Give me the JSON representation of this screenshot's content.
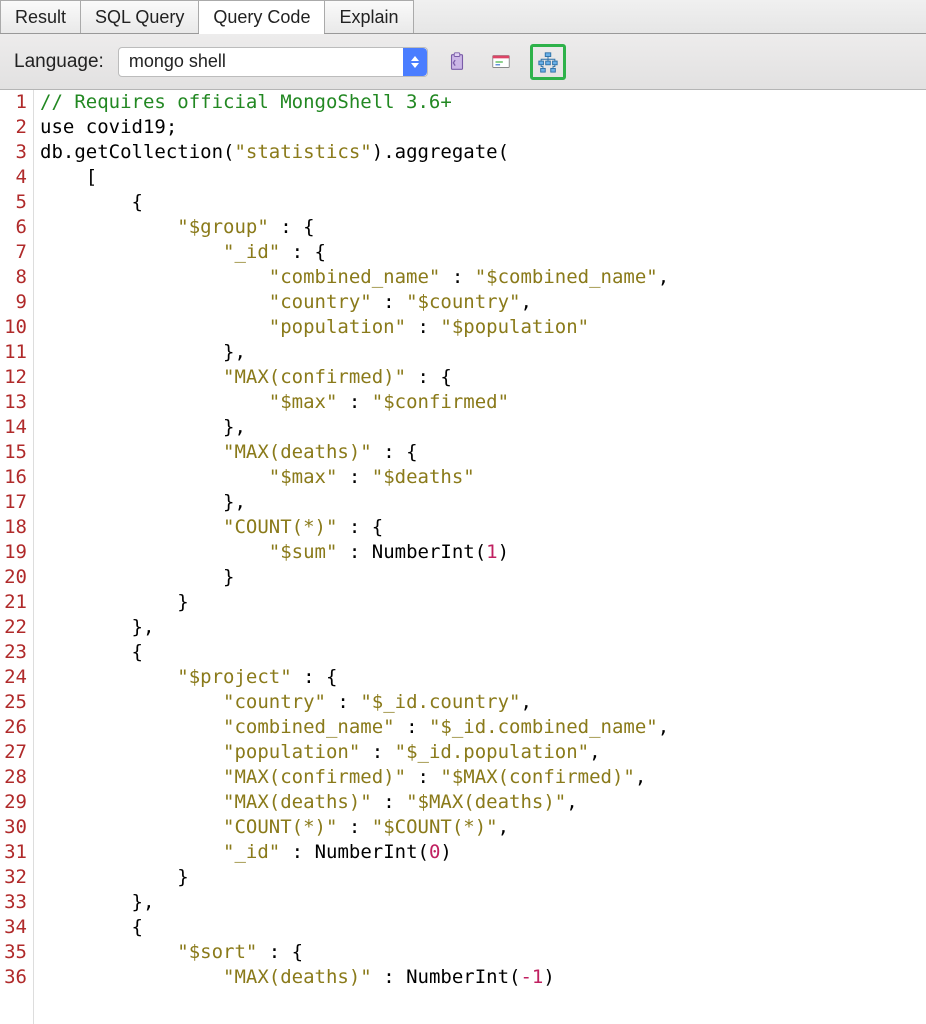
{
  "tabs": {
    "result": "Result",
    "sql": "SQL Query",
    "code": "Query Code",
    "explain": "Explain",
    "active": "code"
  },
  "toolbar": {
    "language_label": "Language:",
    "language_value": "mongo shell"
  },
  "code_lines": [
    {
      "n": 1,
      "segs": [
        {
          "t": "// Requires official MongoShell 3.6+",
          "c": "c-comment"
        }
      ]
    },
    {
      "n": 2,
      "segs": [
        {
          "t": "use covid19;",
          "c": "c-ident"
        }
      ]
    },
    {
      "n": 3,
      "segs": [
        {
          "t": "db.getCollection(",
          "c": "c-ident"
        },
        {
          "t": "\"statistics\"",
          "c": "c-str"
        },
        {
          "t": ").aggregate(",
          "c": "c-ident"
        }
      ]
    },
    {
      "n": 4,
      "segs": [
        {
          "t": "    [",
          "c": "c-punct"
        }
      ]
    },
    {
      "n": 5,
      "segs": [
        {
          "t": "        {",
          "c": "c-punct"
        }
      ]
    },
    {
      "n": 6,
      "segs": [
        {
          "t": "            ",
          "c": ""
        },
        {
          "t": "\"$group\"",
          "c": "c-key"
        },
        {
          "t": " : {",
          "c": "c-punct"
        }
      ]
    },
    {
      "n": 7,
      "segs": [
        {
          "t": "                ",
          "c": ""
        },
        {
          "t": "\"_id\"",
          "c": "c-key"
        },
        {
          "t": " : {",
          "c": "c-punct"
        }
      ]
    },
    {
      "n": 8,
      "segs": [
        {
          "t": "                    ",
          "c": ""
        },
        {
          "t": "\"combined_name\"",
          "c": "c-key"
        },
        {
          "t": " : ",
          "c": "c-punct"
        },
        {
          "t": "\"$combined_name\"",
          "c": "c-str"
        },
        {
          "t": ",",
          "c": "c-punct"
        }
      ]
    },
    {
      "n": 9,
      "segs": [
        {
          "t": "                    ",
          "c": ""
        },
        {
          "t": "\"country\"",
          "c": "c-key"
        },
        {
          "t": " : ",
          "c": "c-punct"
        },
        {
          "t": "\"$country\"",
          "c": "c-str"
        },
        {
          "t": ",",
          "c": "c-punct"
        }
      ]
    },
    {
      "n": 10,
      "segs": [
        {
          "t": "                    ",
          "c": ""
        },
        {
          "t": "\"population\"",
          "c": "c-key"
        },
        {
          "t": " : ",
          "c": "c-punct"
        },
        {
          "t": "\"$population\"",
          "c": "c-str"
        }
      ]
    },
    {
      "n": 11,
      "segs": [
        {
          "t": "                },",
          "c": "c-punct"
        }
      ]
    },
    {
      "n": 12,
      "segs": [
        {
          "t": "                ",
          "c": ""
        },
        {
          "t": "\"MAX(confirmed)\"",
          "c": "c-key"
        },
        {
          "t": " : {",
          "c": "c-punct"
        }
      ]
    },
    {
      "n": 13,
      "segs": [
        {
          "t": "                    ",
          "c": ""
        },
        {
          "t": "\"$max\"",
          "c": "c-key"
        },
        {
          "t": " : ",
          "c": "c-punct"
        },
        {
          "t": "\"$confirmed\"",
          "c": "c-str"
        }
      ]
    },
    {
      "n": 14,
      "segs": [
        {
          "t": "                },",
          "c": "c-punct"
        }
      ]
    },
    {
      "n": 15,
      "segs": [
        {
          "t": "                ",
          "c": ""
        },
        {
          "t": "\"MAX(deaths)\"",
          "c": "c-key"
        },
        {
          "t": " : {",
          "c": "c-punct"
        }
      ]
    },
    {
      "n": 16,
      "segs": [
        {
          "t": "                    ",
          "c": ""
        },
        {
          "t": "\"$max\"",
          "c": "c-key"
        },
        {
          "t": " : ",
          "c": "c-punct"
        },
        {
          "t": "\"$deaths\"",
          "c": "c-str"
        }
      ]
    },
    {
      "n": 17,
      "segs": [
        {
          "t": "                },",
          "c": "c-punct"
        }
      ]
    },
    {
      "n": 18,
      "segs": [
        {
          "t": "                ",
          "c": ""
        },
        {
          "t": "\"COUNT(*)\"",
          "c": "c-key"
        },
        {
          "t": " : {",
          "c": "c-punct"
        }
      ]
    },
    {
      "n": 19,
      "segs": [
        {
          "t": "                    ",
          "c": ""
        },
        {
          "t": "\"$sum\"",
          "c": "c-key"
        },
        {
          "t": " : ",
          "c": "c-punct"
        },
        {
          "t": "NumberInt(",
          "c": "c-fn"
        },
        {
          "t": "1",
          "c": "c-num"
        },
        {
          "t": ")",
          "c": "c-fn"
        }
      ]
    },
    {
      "n": 20,
      "segs": [
        {
          "t": "                }",
          "c": "c-punct"
        }
      ]
    },
    {
      "n": 21,
      "segs": [
        {
          "t": "            }",
          "c": "c-punct"
        }
      ]
    },
    {
      "n": 22,
      "segs": [
        {
          "t": "        },",
          "c": "c-punct"
        }
      ]
    },
    {
      "n": 23,
      "segs": [
        {
          "t": "        {",
          "c": "c-punct"
        }
      ]
    },
    {
      "n": 24,
      "segs": [
        {
          "t": "            ",
          "c": ""
        },
        {
          "t": "\"$project\"",
          "c": "c-key"
        },
        {
          "t": " : {",
          "c": "c-punct"
        }
      ]
    },
    {
      "n": 25,
      "segs": [
        {
          "t": "                ",
          "c": ""
        },
        {
          "t": "\"country\"",
          "c": "c-key"
        },
        {
          "t": " : ",
          "c": "c-punct"
        },
        {
          "t": "\"$_id.country\"",
          "c": "c-str"
        },
        {
          "t": ",",
          "c": "c-punct"
        }
      ]
    },
    {
      "n": 26,
      "segs": [
        {
          "t": "                ",
          "c": ""
        },
        {
          "t": "\"combined_name\"",
          "c": "c-key"
        },
        {
          "t": " : ",
          "c": "c-punct"
        },
        {
          "t": "\"$_id.combined_name\"",
          "c": "c-str"
        },
        {
          "t": ",",
          "c": "c-punct"
        }
      ]
    },
    {
      "n": 27,
      "segs": [
        {
          "t": "                ",
          "c": ""
        },
        {
          "t": "\"population\"",
          "c": "c-key"
        },
        {
          "t": " : ",
          "c": "c-punct"
        },
        {
          "t": "\"$_id.population\"",
          "c": "c-str"
        },
        {
          "t": ",",
          "c": "c-punct"
        }
      ]
    },
    {
      "n": 28,
      "segs": [
        {
          "t": "                ",
          "c": ""
        },
        {
          "t": "\"MAX(confirmed)\"",
          "c": "c-key"
        },
        {
          "t": " : ",
          "c": "c-punct"
        },
        {
          "t": "\"$MAX(confirmed)\"",
          "c": "c-str"
        },
        {
          "t": ",",
          "c": "c-punct"
        }
      ]
    },
    {
      "n": 29,
      "segs": [
        {
          "t": "                ",
          "c": ""
        },
        {
          "t": "\"MAX(deaths)\"",
          "c": "c-key"
        },
        {
          "t": " : ",
          "c": "c-punct"
        },
        {
          "t": "\"$MAX(deaths)\"",
          "c": "c-str"
        },
        {
          "t": ",",
          "c": "c-punct"
        }
      ]
    },
    {
      "n": 30,
      "segs": [
        {
          "t": "                ",
          "c": ""
        },
        {
          "t": "\"COUNT(*)\"",
          "c": "c-key"
        },
        {
          "t": " : ",
          "c": "c-punct"
        },
        {
          "t": "\"$COUNT(*)\"",
          "c": "c-str"
        },
        {
          "t": ",",
          "c": "c-punct"
        }
      ]
    },
    {
      "n": 31,
      "segs": [
        {
          "t": "                ",
          "c": ""
        },
        {
          "t": "\"_id\"",
          "c": "c-key"
        },
        {
          "t": " : ",
          "c": "c-punct"
        },
        {
          "t": "NumberInt(",
          "c": "c-fn"
        },
        {
          "t": "0",
          "c": "c-num"
        },
        {
          "t": ")",
          "c": "c-fn"
        }
      ]
    },
    {
      "n": 32,
      "segs": [
        {
          "t": "            }",
          "c": "c-punct"
        }
      ]
    },
    {
      "n": 33,
      "segs": [
        {
          "t": "        },",
          "c": "c-punct"
        }
      ]
    },
    {
      "n": 34,
      "segs": [
        {
          "t": "        {",
          "c": "c-punct"
        }
      ]
    },
    {
      "n": 35,
      "segs": [
        {
          "t": "            ",
          "c": ""
        },
        {
          "t": "\"$sort\"",
          "c": "c-key"
        },
        {
          "t": " : {",
          "c": "c-punct"
        }
      ]
    },
    {
      "n": 36,
      "segs": [
        {
          "t": "                ",
          "c": ""
        },
        {
          "t": "\"MAX(deaths)\"",
          "c": "c-key"
        },
        {
          "t": " : ",
          "c": "c-punct"
        },
        {
          "t": "NumberInt(",
          "c": "c-fn"
        },
        {
          "t": "-1",
          "c": "c-num"
        },
        {
          "t": ")",
          "c": "c-fn"
        }
      ]
    }
  ]
}
